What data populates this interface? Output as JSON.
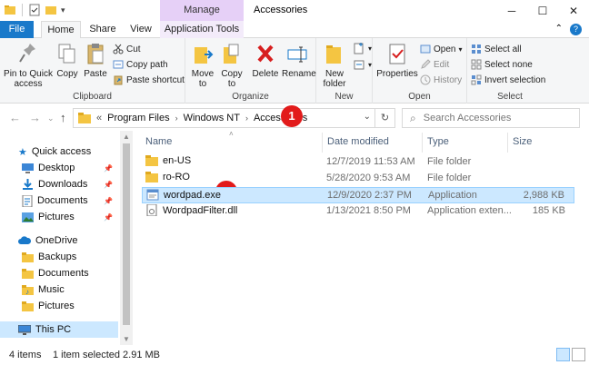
{
  "window": {
    "title": "Accessories",
    "contextual_tab_header": "Manage",
    "controls": [
      "minimize",
      "maximize",
      "close"
    ]
  },
  "ribbon_tabs": [
    "File",
    "Home",
    "Share",
    "View",
    "Application Tools"
  ],
  "ribbon": {
    "clipboard": {
      "label": "Clipboard",
      "pin": "Pin to Quick\naccess",
      "copy": "Copy",
      "paste": "Paste",
      "cut": "Cut",
      "copy_path": "Copy path",
      "paste_shortcut": "Paste shortcut"
    },
    "organize": {
      "label": "Organize",
      "move_to": "Move\nto",
      "copy_to": "Copy\nto",
      "delete": "Delete",
      "rename": "Rename"
    },
    "new": {
      "label": "New",
      "new_folder": "New\nfolder"
    },
    "open": {
      "label": "Open",
      "properties": "Properties",
      "open": "Open",
      "edit": "Edit",
      "history": "History"
    },
    "select": {
      "label": "Select",
      "select_all": "Select all",
      "select_none": "Select none",
      "invert": "Invert selection"
    }
  },
  "address": {
    "overflow": "«",
    "crumbs": [
      "Program Files",
      "Windows NT",
      "Accessories"
    ],
    "search_placeholder": "Search Accessories"
  },
  "badges": [
    "1",
    "2"
  ],
  "nav_pane": [
    {
      "label": "Quick access",
      "icon": "star-icon"
    },
    {
      "label": "Desktop",
      "icon": "desktop-icon",
      "pinned": true
    },
    {
      "label": "Downloads",
      "icon": "download-icon",
      "pinned": true
    },
    {
      "label": "Documents",
      "icon": "documents-icon",
      "pinned": true
    },
    {
      "label": "Pictures",
      "icon": "pictures-icon",
      "pinned": true
    },
    {
      "label": "OneDrive",
      "icon": "cloud-icon"
    },
    {
      "label": "Backups",
      "icon": "folder-icon"
    },
    {
      "label": "Documents",
      "icon": "folder-icon"
    },
    {
      "label": "Music",
      "icon": "music-icon"
    },
    {
      "label": "Pictures",
      "icon": "folder-icon"
    },
    {
      "label": "This PC",
      "icon": "computer-icon"
    }
  ],
  "columns": [
    "Name",
    "Date modified",
    "Type",
    "Size"
  ],
  "files": [
    {
      "name": "en-US",
      "date": "12/7/2019 11:53 AM",
      "type": "File folder",
      "size": "",
      "icon": "folder-icon"
    },
    {
      "name": "ro-RO",
      "date": "5/28/2020 9:53 AM",
      "type": "File folder",
      "size": "",
      "icon": "folder-icon"
    },
    {
      "name": "wordpad.exe",
      "date": "12/9/2020 2:37 PM",
      "type": "Application",
      "size": "2,988 KB",
      "icon": "application-icon",
      "selected": true
    },
    {
      "name": "WordpadFilter.dll",
      "date": "1/13/2021 8:50 PM",
      "type": "Application exten...",
      "size": "185 KB",
      "icon": "dll-icon"
    }
  ],
  "status": {
    "items": "4 items",
    "selected": "1 item selected  2.91 MB"
  },
  "colors": {
    "accent": "#1979ca",
    "manage_tab": "#e6d0f7",
    "selection": "#cce8ff",
    "badge": "#e21b1b",
    "folder": "#f4c542"
  }
}
